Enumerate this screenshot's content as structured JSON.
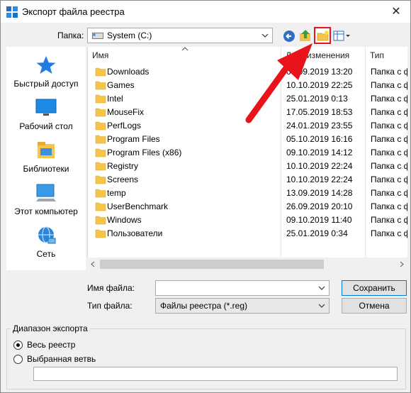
{
  "window": {
    "title": "Экспорт файла реестра",
    "close_glyph": "✕"
  },
  "location": {
    "label": "Папка:",
    "value": "System (C:)"
  },
  "toolbar": {
    "back_icon": "back-arrow-icon",
    "up_icon": "up-folder-icon",
    "new_folder_icon": "new-folder-icon",
    "view_icon": "view-menu-icon"
  },
  "sidebar": {
    "items": [
      {
        "label": "Быстрый доступ",
        "icon": "star-icon"
      },
      {
        "label": "Рабочий стол",
        "icon": "desktop-icon"
      },
      {
        "label": "Библиотеки",
        "icon": "libraries-icon"
      },
      {
        "label": "Этот компьютер",
        "icon": "computer-icon"
      },
      {
        "label": "Сеть",
        "icon": "network-icon"
      }
    ]
  },
  "filelist": {
    "columns": {
      "name": "Имя",
      "date": "Дата изменения",
      "type": "Тип"
    },
    "rows": [
      {
        "name": "Downloads",
        "date": "09.09.2019 13:20",
        "type": "Папка с ф"
      },
      {
        "name": "Games",
        "date": "10.10.2019 22:25",
        "type": "Папка с ф"
      },
      {
        "name": "Intel",
        "date": "25.01.2019 0:13",
        "type": "Папка с ф"
      },
      {
        "name": "MouseFix",
        "date": "17.05.2019 18:53",
        "type": "Папка с ф"
      },
      {
        "name": "PerfLogs",
        "date": "24.01.2019 23:55",
        "type": "Папка с ф"
      },
      {
        "name": "Program Files",
        "date": "05.10.2019 16:16",
        "type": "Папка с ф"
      },
      {
        "name": "Program Files (x86)",
        "date": "09.10.2019 14:12",
        "type": "Папка с ф"
      },
      {
        "name": "Registry",
        "date": "10.10.2019 22:24",
        "type": "Папка с ф"
      },
      {
        "name": "Screens",
        "date": "10.10.2019 22:24",
        "type": "Папка с ф"
      },
      {
        "name": "temp",
        "date": "13.09.2019 14:28",
        "type": "Папка с ф"
      },
      {
        "name": "UserBenchmark",
        "date": "26.09.2019 20:10",
        "type": "Папка с ф"
      },
      {
        "name": "Windows",
        "date": "09.10.2019 11:40",
        "type": "Папка с ф"
      },
      {
        "name": "Пользователи",
        "date": "25.01.2019 0:34",
        "type": "Папка с ф"
      }
    ]
  },
  "form": {
    "filename_label": "Имя файла:",
    "filename_value": "",
    "filetype_label": "Тип файла:",
    "filetype_value": "Файлы реестра (*.reg)",
    "save_label": "Сохранить",
    "cancel_label": "Отмена"
  },
  "export_range": {
    "title": "Диапазон экспорта",
    "option_all": "Весь реестр",
    "option_branch": "Выбранная ветвь",
    "branch_value": ""
  },
  "colors": {
    "accent": "#0078d7",
    "folder": "#f6c448",
    "annotation": "#e8131b"
  }
}
